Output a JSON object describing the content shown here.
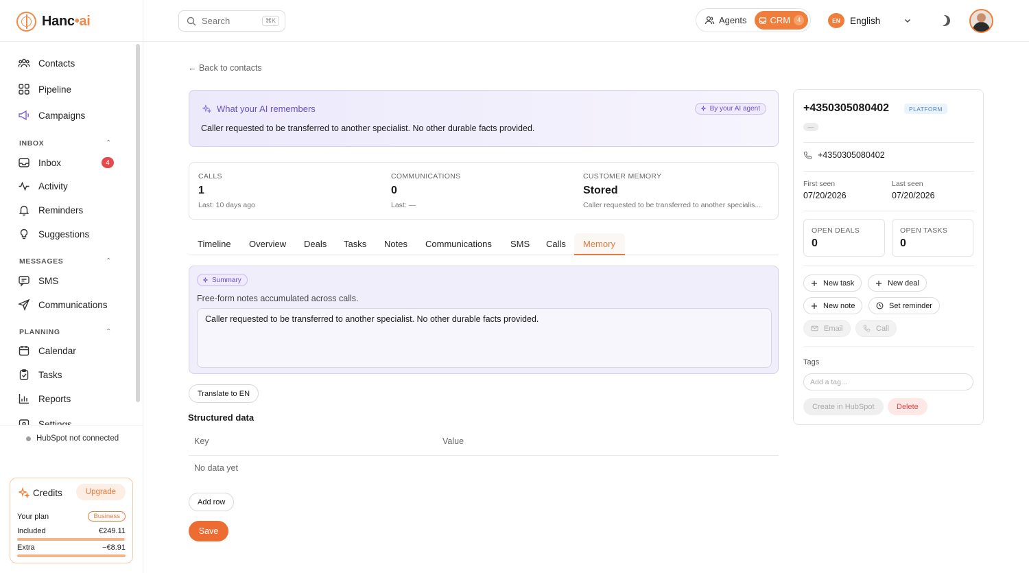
{
  "brand": {
    "name_part1": "Hanc",
    "name_dot": "•",
    "name_part2": "ai",
    "accent": "#ef7e3c"
  },
  "search": {
    "placeholder": "Search",
    "shortcut": "⌘K"
  },
  "header": {
    "agents_label": "Agents",
    "crm_label": "CRM",
    "crm_count": "4",
    "language_code": "EN",
    "language_label": "English"
  },
  "sidebar": {
    "primary": [
      {
        "label": "Contacts",
        "icon": "contacts-icon"
      },
      {
        "label": "Pipeline",
        "icon": "pipeline-icon"
      },
      {
        "label": "Campaigns",
        "icon": "megaphone-icon"
      }
    ],
    "inbox_section": "INBOX",
    "inbox_items": [
      {
        "label": "Inbox",
        "badge": "4",
        "icon": "inbox-icon"
      },
      {
        "label": "Activity",
        "icon": "activity-icon"
      },
      {
        "label": "Reminders",
        "icon": "bell-icon"
      },
      {
        "label": "Suggestions",
        "icon": "bulb-icon"
      }
    ],
    "messages_section": "MESSAGES",
    "messages_items": [
      {
        "label": "SMS",
        "icon": "sms-icon"
      },
      {
        "label": "Communications",
        "icon": "send-icon"
      }
    ],
    "planning_section": "PLANNING",
    "planning_items": [
      {
        "label": "Calendar",
        "icon": "calendar-icon"
      },
      {
        "label": "Tasks",
        "icon": "clipboard-icon"
      },
      {
        "label": "Reports",
        "icon": "chart-icon"
      },
      {
        "label": "Settings",
        "icon": "settings-icon"
      }
    ],
    "hubspot_status": "HubSpot not connected"
  },
  "credits": {
    "title": "Credits",
    "upgrade": "Upgrade",
    "plan_label": "Your plan",
    "plan_name": "Business",
    "included_label": "Included",
    "included_value": "€249.11",
    "included_fraction": 0.99,
    "extra_label": "Extra",
    "extra_value": "−€8.91",
    "extra_fraction": 1.0
  },
  "main": {
    "back_link": "← Back to contacts",
    "memory": {
      "title": "What your AI remembers",
      "badge": "By your AI agent",
      "text": "Caller requested to be transferred to another specialist. No other durable facts provided."
    },
    "stats": [
      {
        "label": "CALLS",
        "value": "1",
        "sub": "Last: 10 days ago"
      },
      {
        "label": "COMMUNICATIONS",
        "value": "0",
        "sub": "Last: —"
      },
      {
        "label": "CUSTOMER MEMORY",
        "value": "Stored",
        "sub": "Caller requested to be transferred to another specialis..."
      }
    ],
    "tabs": [
      "Timeline",
      "Overview",
      "Deals",
      "Tasks",
      "Notes",
      "Communications",
      "SMS",
      "Calls",
      "Memory"
    ],
    "active_tab": "Memory",
    "summary": {
      "pill": "Summary",
      "description": "Free-form notes accumulated across calls.",
      "value": "Caller requested to be transferred to another specialist. No other durable facts provided."
    },
    "translate_btn": "Translate to EN",
    "structured_title": "Structured data",
    "table_headers": [
      "Key",
      "Value"
    ],
    "empty_text": "No data yet",
    "add_row": "Add row",
    "save": "Save"
  },
  "contact": {
    "phone_title": "+4350305080402",
    "source_badge": "PLATFORM",
    "placeholder_dash": "—",
    "phone": "+4350305080402",
    "first_seen_label": "First seen",
    "first_seen": "07/20/2026",
    "last_seen_label": "Last seen",
    "last_seen": "07/20/2026",
    "open_deals_label": "OPEN DEALS",
    "open_deals": "0",
    "open_tasks_label": "OPEN TASKS",
    "open_tasks": "0",
    "actions": {
      "new_task": "New task",
      "new_deal": "New deal",
      "new_note": "New note",
      "set_reminder": "Set reminder",
      "email": "Email",
      "call": "Call"
    },
    "tags_label": "Tags",
    "tag_placeholder": "Add a tag...",
    "hubspot_btn": "Create in HubSpot",
    "delete_btn": "Delete"
  }
}
